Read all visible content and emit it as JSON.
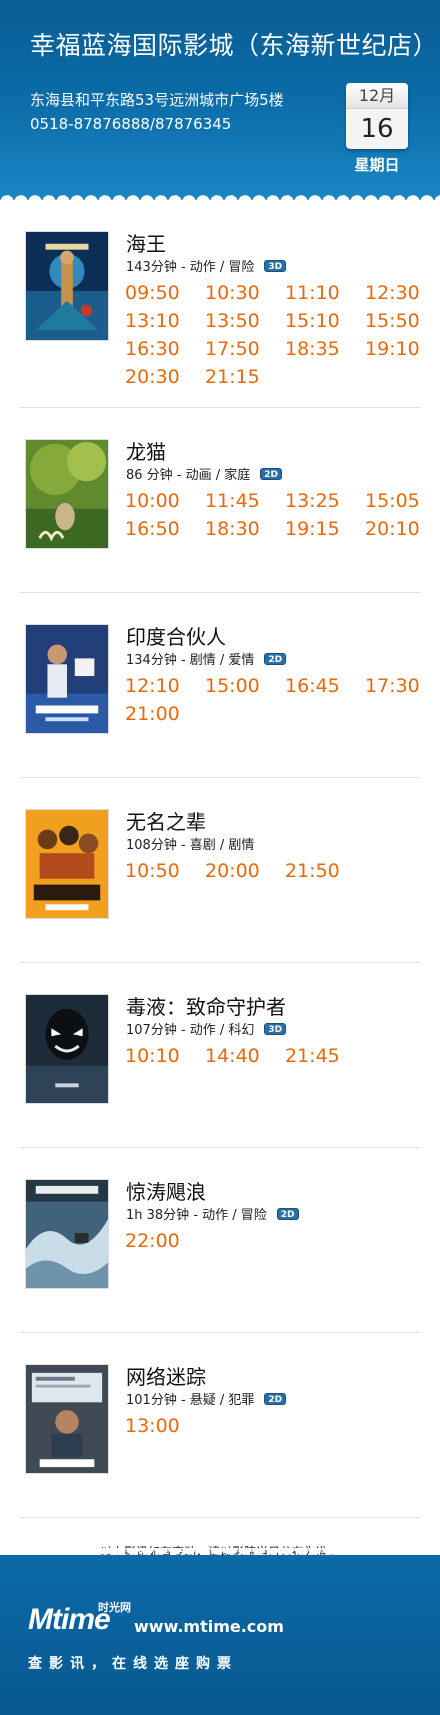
{
  "header": {
    "title": "幸福蓝海国际影城（东海新世纪店）",
    "address": "东海县和平东路53号远洲城市广场5楼",
    "phone": "0518-87876888/87876345",
    "calendar": {
      "month": "12月",
      "day": "16",
      "weekday": "星期日"
    }
  },
  "movies": [
    {
      "title": "海王",
      "meta": "143分钟 - 动作 / 冒险",
      "format": "3D",
      "poster_icon": "aquaman-poster",
      "showtimes": [
        "09:50",
        "10:30",
        "11:10",
        "12:30",
        "13:10",
        "13:50",
        "15:10",
        "15:50",
        "16:30",
        "17:50",
        "18:35",
        "19:10",
        "20:30",
        "21:15"
      ]
    },
    {
      "title": "龙猫",
      "meta": "86 分钟 - 动画 / 家庭",
      "format": "2D",
      "poster_icon": "totoro-poster",
      "showtimes": [
        "10:00",
        "11:45",
        "13:25",
        "15:05",
        "16:50",
        "18:30",
        "19:15",
        "20:10"
      ]
    },
    {
      "title": "印度合伙人",
      "meta": "134分钟 - 剧情 / 爱情",
      "format": "2D",
      "poster_icon": "padman-poster",
      "showtimes": [
        "12:10",
        "15:00",
        "16:45",
        "17:30",
        "21:00"
      ]
    },
    {
      "title": "无名之辈",
      "meta": "108分钟 - 喜剧 / 剧情",
      "format": "",
      "poster_icon": "wumingzhibei-poster",
      "showtimes": [
        "10:50",
        "20:00",
        "21:50"
      ]
    },
    {
      "title": "毒液：致命守护者",
      "meta": "107分钟 - 动作 / 科幻",
      "format": "3D",
      "poster_icon": "venom-poster",
      "showtimes": [
        "10:10",
        "14:40",
        "21:45"
      ]
    },
    {
      "title": "惊涛飓浪",
      "meta": "1h 38分钟 - 动作 / 冒险",
      "format": "2D",
      "poster_icon": "storm-poster",
      "showtimes": [
        "22:00"
      ]
    },
    {
      "title": "网络迷踪",
      "meta": "101分钟 - 悬疑 / 犯罪",
      "format": "2D",
      "poster_icon": "searching-poster",
      "showtimes": [
        "13:00"
      ]
    }
  ],
  "notice": "以上影讯如有变动，请以影院当日公布为准。",
  "footer": {
    "logo_mark": "Mtime",
    "logo_cn": "时光网",
    "url": "www.mtime.com",
    "slogan": "查影讯，在线选座购票"
  },
  "colors": {
    "header_blue": "#0a6aa6",
    "showtime_orange": "#e8690b",
    "badge_blue": "#2a6fa6"
  }
}
